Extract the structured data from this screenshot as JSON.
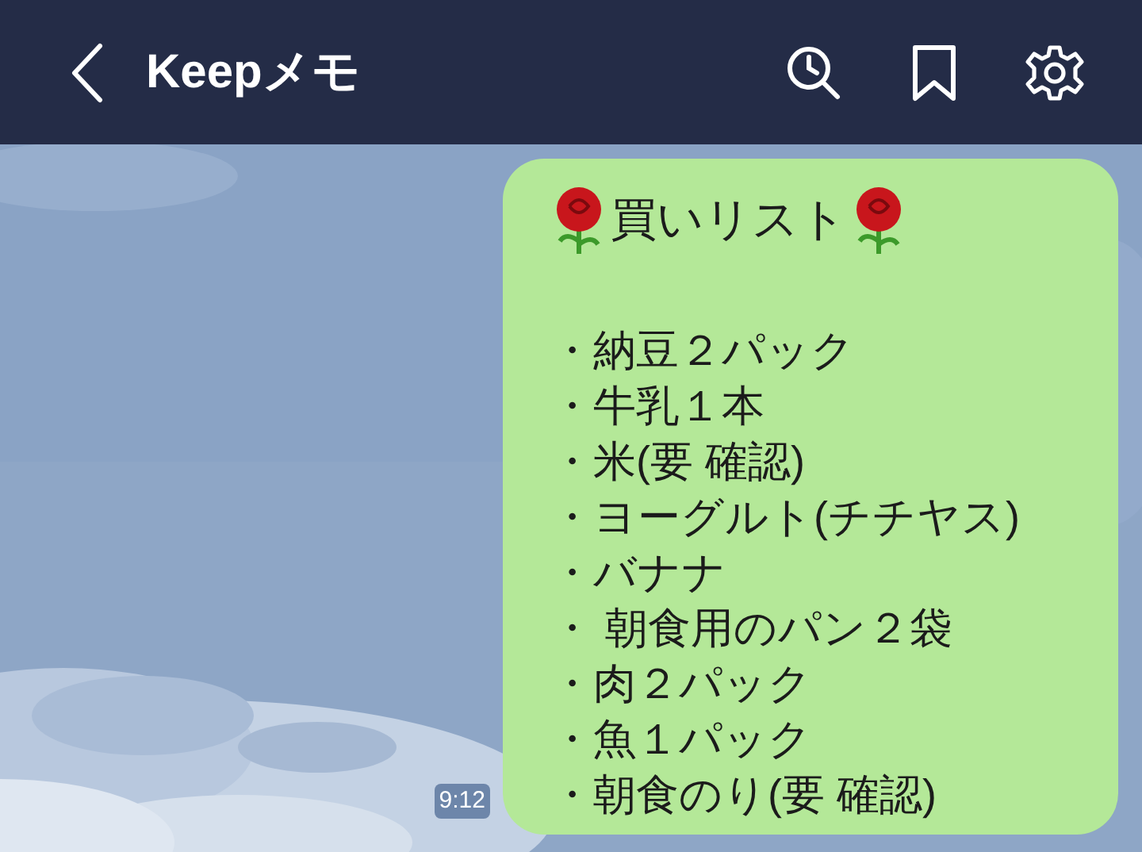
{
  "header": {
    "title": "Keepメモ"
  },
  "message": {
    "title": "買いリスト",
    "lines": [
      "・納豆２パック",
      "・牛乳１本",
      "・米(要 確認)",
      "・ヨーグルト(チチヤス)",
      "・バナナ",
      "・ 朝食用のパン２袋",
      "・肉２パック",
      "・魚１パック",
      "・朝食のり(要 確認)"
    ],
    "time": "9:12"
  }
}
